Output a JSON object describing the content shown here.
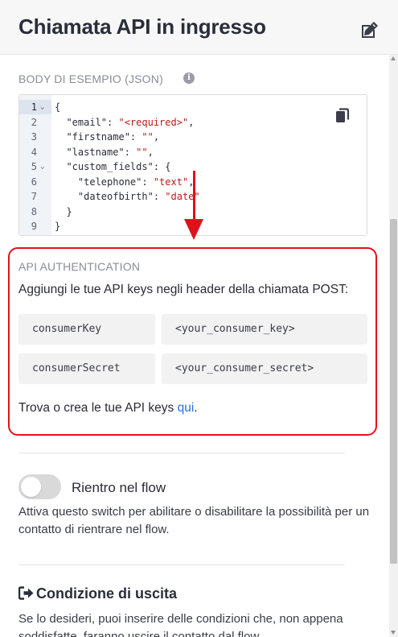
{
  "header": {
    "title": "Chiamata API in ingresso",
    "edit_icon": "edit-icon"
  },
  "example_body": {
    "label": "BODY DI ESEMPIO (JSON)",
    "info_icon": "info-icon",
    "lines": [
      {
        "num": "1",
        "fold": true,
        "text": "{"
      },
      {
        "num": "2",
        "fold": false,
        "key": "  \"email\": ",
        "value": "\"<required>\"",
        "tail": ","
      },
      {
        "num": "3",
        "fold": false,
        "key": "  \"firstname\": ",
        "value": "\"\"",
        "tail": ","
      },
      {
        "num": "4",
        "fold": false,
        "key": "  \"lastname\": ",
        "value": "\"\"",
        "tail": ","
      },
      {
        "num": "5",
        "fold": true,
        "key": "  \"custom_fields\": ",
        "value": "",
        "tail": "{"
      },
      {
        "num": "6",
        "fold": false,
        "key": "    \"telephone\": ",
        "value": "\"text\"",
        "tail": ","
      },
      {
        "num": "7",
        "fold": false,
        "key": "    \"dateofbirth\": ",
        "value": "\"date\"",
        "tail": ""
      },
      {
        "num": "8",
        "fold": false,
        "text": "  }"
      },
      {
        "num": "9",
        "fold": false,
        "text": "}"
      }
    ],
    "copy_icon": "copy-icon"
  },
  "api_auth": {
    "title": "API AUTHENTICATION",
    "description": "Aggiungi le tue API keys negli header della chiamata POST:",
    "rows": [
      {
        "name": "consumerKey",
        "value": "<your_consumer_key>"
      },
      {
        "name": "consumerSecret",
        "value": "<your_consumer_secret>"
      }
    ],
    "footer_text": "Trova o crea le tue API keys ",
    "footer_link": "qui",
    "footer_end": "."
  },
  "reentry": {
    "label": "Rientro nel flow",
    "enabled": false,
    "description": "Attiva questo switch per abilitare o disabilitare la possibilità per un contatto di rientrare nel flow."
  },
  "exit_condition": {
    "icon": "sign-out-icon",
    "title": "Condizione di uscita",
    "description": "Se lo desideri, puoi inserire delle condizioni che, non appena soddisfatte, faranno uscire il contatto dal flow."
  },
  "colors": {
    "annotation_red": "#e0111b",
    "link_blue": "#2a6fdb",
    "string_red": "#b71c1c"
  }
}
